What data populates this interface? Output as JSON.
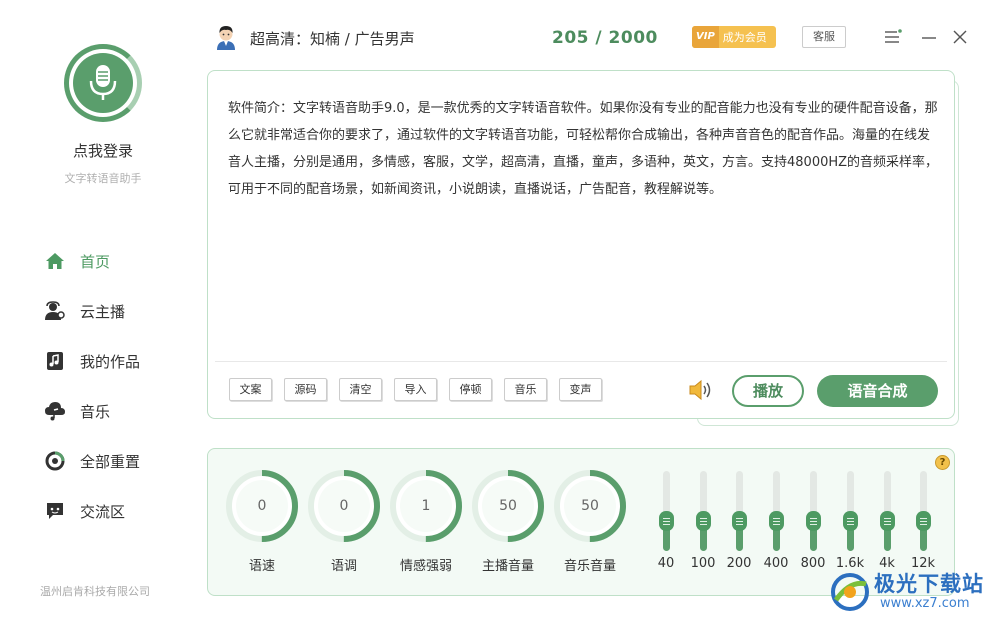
{
  "sidebar": {
    "login_label": "点我登录",
    "app_subtitle": "文字转语音助手",
    "company": "温州启肯科技有限公司",
    "nav": [
      {
        "label": "首页",
        "icon": "home-icon",
        "active": true
      },
      {
        "label": "云主播",
        "icon": "cloud-anchor-icon",
        "active": false
      },
      {
        "label": "我的作品",
        "icon": "works-icon",
        "active": false
      },
      {
        "label": "音乐",
        "icon": "music-cloud-icon",
        "active": false
      },
      {
        "label": "全部重置",
        "icon": "reset-icon",
        "active": false
      },
      {
        "label": "交流区",
        "icon": "chat-icon",
        "active": false
      }
    ]
  },
  "header": {
    "voice_title": "超高清：知楠 / 广告男声",
    "counter": "205 / 2000",
    "vip_tag": "VIP",
    "vip_label": "成为会员",
    "service_label": "客服"
  },
  "editor": {
    "text": "软件简介：文字转语音助手9.0，是一款优秀的文字转语音软件。如果你没有专业的配音能力也没有专业的硬件配音设备，那么它就非常适合你的要求了，通过软件的文字转语音功能，可轻松帮你合成输出，各种声音音色的配音作品。海量的在线发音人主播，分别是通用，多情感，客服，文学，超高清，直播，童声，多语种，英文，方言。支持48000HZ的音频采样率，可用于不同的配音场景，如新闻资讯，小说朗读，直播说话，广告配音，教程解说等。",
    "tools": [
      "文案",
      "源码",
      "清空",
      "导入",
      "停顿",
      "音乐",
      "变声"
    ],
    "play_label": "播放",
    "synth_label": "语音合成"
  },
  "controls": {
    "dials": [
      {
        "label": "语速",
        "value": "0",
        "fraction": 0.5
      },
      {
        "label": "语调",
        "value": "0",
        "fraction": 0.5
      },
      {
        "label": "情感强弱",
        "value": "1",
        "fraction": 0.5
      },
      {
        "label": "主播音量",
        "value": "50",
        "fraction": 0.5
      },
      {
        "label": "音乐音量",
        "value": "50",
        "fraction": 0.5
      }
    ],
    "eq_bands": [
      {
        "label": "40",
        "level": 0.5
      },
      {
        "label": "100",
        "level": 0.5
      },
      {
        "label": "200",
        "level": 0.5
      },
      {
        "label": "400",
        "level": 0.5
      },
      {
        "label": "800",
        "level": 0.5
      },
      {
        "label": "1.6k",
        "level": 0.5
      },
      {
        "label": "4k",
        "level": 0.5
      },
      {
        "label": "12k",
        "level": 0.5
      }
    ],
    "help_label": "?"
  },
  "watermark": {
    "title": "极光下载站",
    "url": "www.xz7.com"
  },
  "colors": {
    "accent": "#5a9e6c",
    "accent_dark": "#4d8c5e",
    "vip": "#f5c150"
  }
}
